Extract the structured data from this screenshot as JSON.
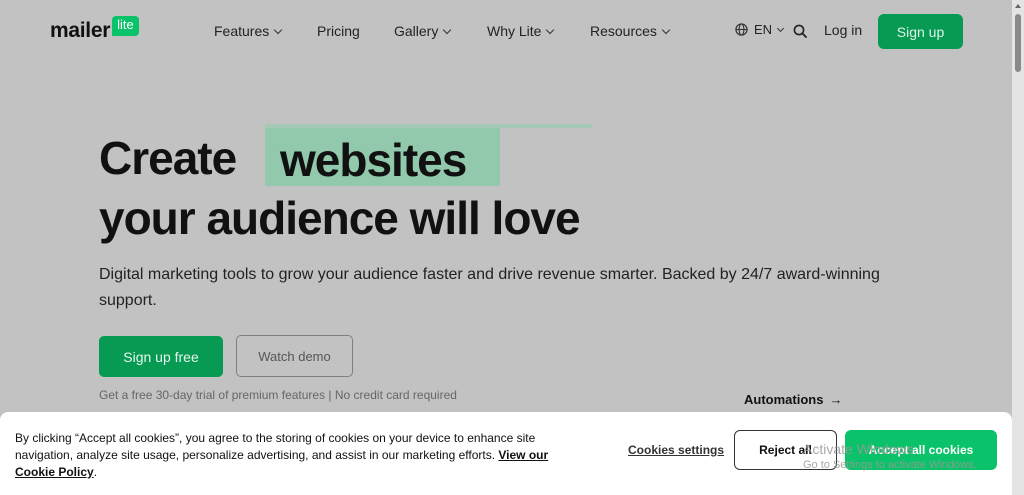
{
  "nav": {
    "logo_text": "mailer",
    "logo_badge": "lite",
    "items": [
      {
        "label": "Features",
        "has_dropdown": true
      },
      {
        "label": "Pricing",
        "has_dropdown": false
      },
      {
        "label": "Gallery",
        "has_dropdown": true
      },
      {
        "label": "Why Lite",
        "has_dropdown": true
      },
      {
        "label": "Resources",
        "has_dropdown": true
      }
    ],
    "language": "EN",
    "login_label": "Log in",
    "signup_label": "Sign up"
  },
  "hero": {
    "line1": "Create",
    "highlight_word": "websites",
    "line2": "your audience will love",
    "subtitle": "Digital marketing tools to grow your audience faster and drive revenue smarter. Backed by 24/7 award-winning support.",
    "primary_button": "Sign up free",
    "secondary_button": "Watch demo",
    "trial_note": "Get a free 30-day trial of premium features | No credit card required",
    "feature_link": "Automations",
    "arrow": "→"
  },
  "cookie": {
    "text": "By clicking “Accept all cookies”, you agree to the storing of cookies on your device to enhance site navigation, analyze site usage, personalize advertising, and assist in our marketing efforts.",
    "policy_link": "View our Cookie Policy",
    "period": ".",
    "settings_label": "Cookies settings",
    "reject_label": "Reject all",
    "accept_label": "Accept all cookies"
  },
  "watermark": {
    "line1": "Activate Windows",
    "line2": "Go to Settings to activate Windows."
  },
  "colors": {
    "brand_green": "#09c269",
    "dim_green": "#079a52",
    "overlay_gray": "#c2c2c2",
    "highlight": "#92c9ad"
  }
}
